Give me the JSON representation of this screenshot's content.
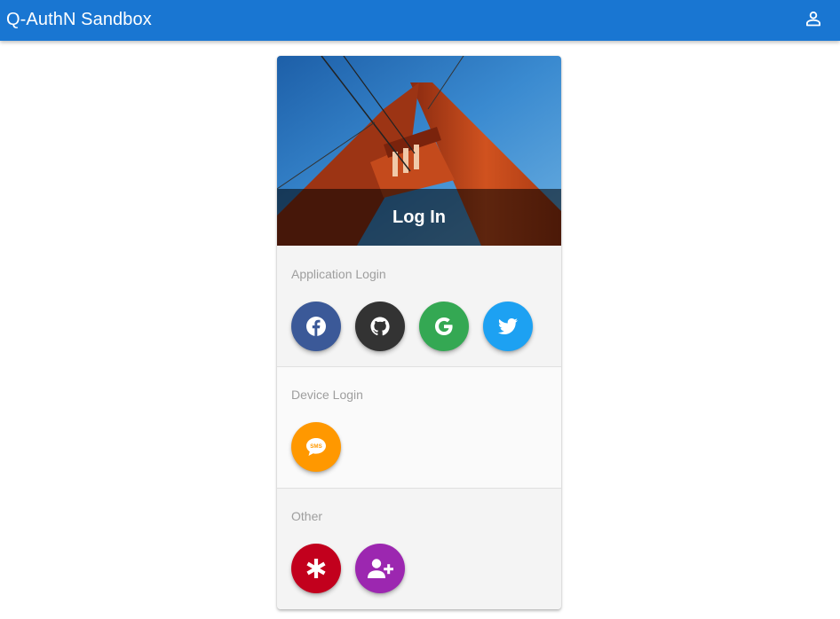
{
  "app": {
    "title": "Q-AuthN Sandbox",
    "user_icon": "account-icon"
  },
  "card": {
    "hero_title": "Log In",
    "sections": [
      {
        "label": "Application Login",
        "buttons": [
          {
            "icon": "facebook-icon",
            "color": "#3b5998"
          },
          {
            "icon": "github-icon",
            "color": "#333333"
          },
          {
            "icon": "google-icon",
            "color": "#34a853"
          },
          {
            "icon": "twitter-icon",
            "color": "#1da1f2"
          }
        ]
      },
      {
        "label": "Device Login",
        "buttons": [
          {
            "icon": "sms-icon",
            "color": "#ff9800"
          }
        ]
      },
      {
        "label": "Other",
        "buttons": [
          {
            "icon": "asterisk-icon",
            "color": "#c2001d"
          },
          {
            "icon": "add-user-icon",
            "color": "#9c27b0"
          }
        ]
      }
    ]
  },
  "colors": {
    "toolbar": "#1976d2",
    "sky": "#2f7fc4",
    "bridge": "#c54a1e"
  }
}
